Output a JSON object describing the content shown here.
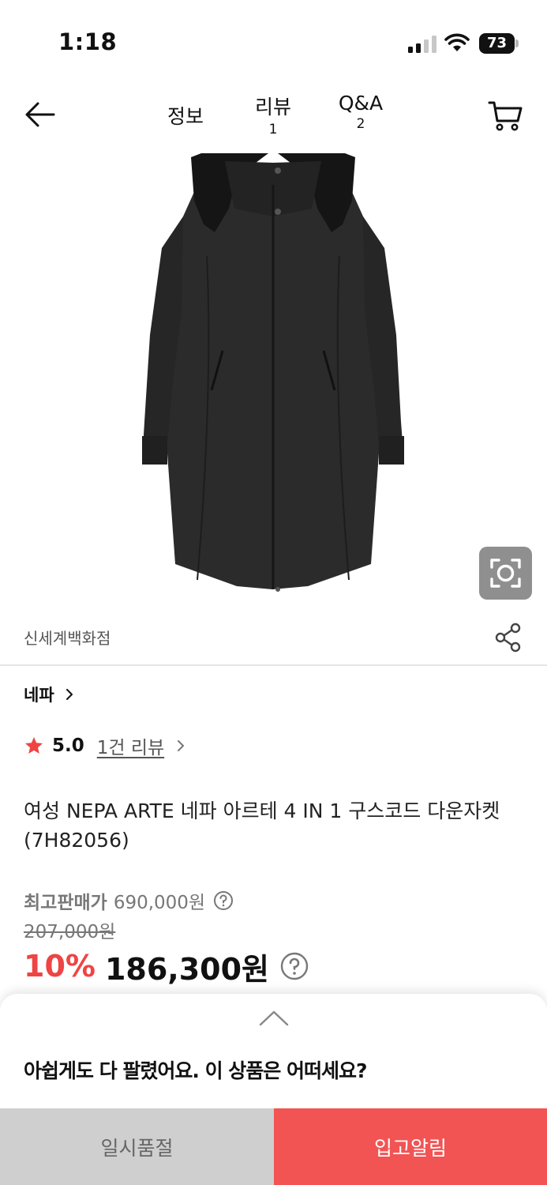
{
  "status_bar": {
    "time": "1:18",
    "battery": "73"
  },
  "nav": {
    "tabs": [
      {
        "label": "정보",
        "count": ""
      },
      {
        "label": "리뷰",
        "count": "1"
      },
      {
        "label": "Q&A",
        "count": "2"
      }
    ]
  },
  "seller": {
    "name": "신세계백화점"
  },
  "brand": {
    "name": "네파"
  },
  "rating": {
    "score": "5.0",
    "review_link": "1건 리뷰"
  },
  "product": {
    "title": "여성 NEPA ARTE 네파 아르테 4 IN 1 구스코드 다운자켓 (7H82056)",
    "price_max_label": "최고판매가",
    "price_max_value": "690,000원",
    "price_original": "207,000원",
    "discount_rate": "10%",
    "final_price": "186,300원"
  },
  "sheet": {
    "message": "아쉽게도 다 팔렸어요. 이 상품은 어떠세요?",
    "soldout_button": "일시품절",
    "notify_button": "입고알림"
  },
  "colors": {
    "accent": "#f25454",
    "discount": "#ef4444",
    "soldout_bg": "#cfcfcf"
  },
  "icons": [
    "back-arrow-icon",
    "cart-icon",
    "lens-search-icon",
    "share-icon",
    "chevron-right-icon",
    "star-icon",
    "help-icon",
    "chevron-up-icon"
  ]
}
